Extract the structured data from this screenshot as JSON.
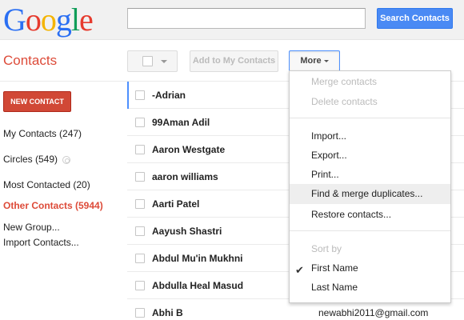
{
  "header": {
    "logo_letters": [
      {
        "ch": "G",
        "color": "#2a6ff3"
      },
      {
        "ch": "o",
        "color": "#e63b2e"
      },
      {
        "ch": "o",
        "color": "#f4b400"
      },
      {
        "ch": "g",
        "color": "#2a6ff3"
      },
      {
        "ch": "l",
        "color": "#0f9d58"
      },
      {
        "ch": "e",
        "color": "#e63b2e"
      }
    ],
    "search_value": "",
    "search_button_label": "Search Contacts"
  },
  "app_title": "Contacts",
  "toolbar": {
    "add_label": "Add to My Contacts",
    "more_label": "More"
  },
  "sidebar": {
    "new_contact_label": "NEW CONTACT",
    "items": [
      {
        "label": "My Contacts (247)"
      },
      {
        "label": "Circles (549)"
      },
      {
        "label": "Most Contacted (20)"
      },
      {
        "label": "Other Contacts (5944)"
      },
      {
        "label": "New Group..."
      },
      {
        "label": "Import Contacts..."
      }
    ]
  },
  "contacts": [
    {
      "name": "-Adrian",
      "email": ""
    },
    {
      "name": "99Aman Adil",
      "email": ""
    },
    {
      "name": "Aaron Westgate",
      "email": ""
    },
    {
      "name": "aaron williams",
      "email": ""
    },
    {
      "name": "Aarti Patel",
      "email": ""
    },
    {
      "name": "Aayush Shastri",
      "email": ""
    },
    {
      "name": "Abdul Mu'in Mukhni",
      "email": ""
    },
    {
      "name": "Abdulla Heal Masud",
      "email": ""
    },
    {
      "name": "Abhi B",
      "email": "newabhi2011@gmail.com"
    }
  ],
  "more_menu": {
    "merge_contacts": "Merge contacts",
    "delete_contacts": "Delete contacts",
    "import": "Import...",
    "export": "Export...",
    "print": "Print...",
    "find_merge": "Find & merge duplicates...",
    "restore": "Restore contacts...",
    "sort_by": "Sort by",
    "first_name": "First Name",
    "last_name": "Last Name"
  },
  "colors": {
    "accent_red": "#dd4b39",
    "search_blue": "#4a8af4",
    "new_contact_red": "#d14836"
  }
}
